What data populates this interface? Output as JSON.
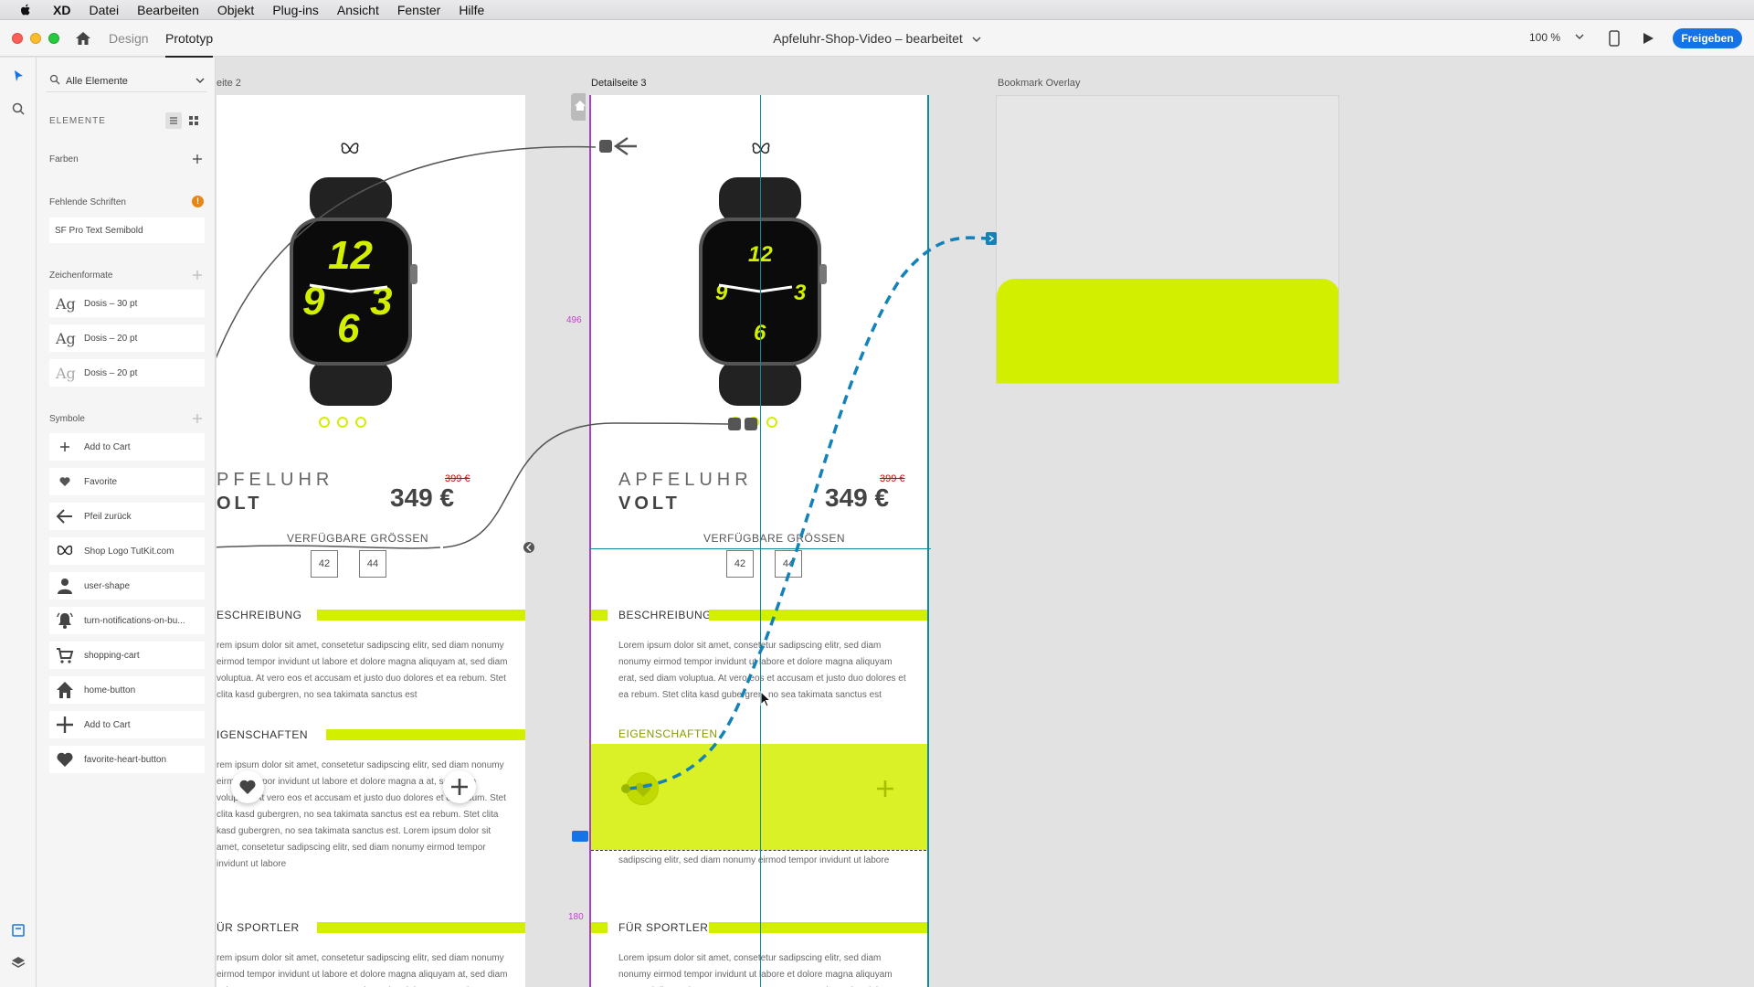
{
  "menubar": {
    "app": "XD",
    "items": [
      "Datei",
      "Bearbeiten",
      "Objekt",
      "Plug-ins",
      "Ansicht",
      "Fenster",
      "Hilfe"
    ]
  },
  "toolbar": {
    "tab_design": "Design",
    "tab_prototype": "Prototyp",
    "doc_title": "Apfeluhr-Shop-Video – bearbeitet",
    "zoom": "100 %",
    "share": "Freigeben"
  },
  "assets": {
    "filter": "Alle Elemente",
    "heading": "ELEMENTE",
    "colors": "Farben",
    "missing_fonts": "Fehlende Schriften",
    "missing_font_name": "SF Pro Text Semibold",
    "warn_badge": "!",
    "char_styles": "Zeichenformate",
    "char_style_items": [
      {
        "ag": "Ag",
        "label": "Dosis – 30 pt"
      },
      {
        "ag": "Ag",
        "label": "Dosis – 20 pt"
      },
      {
        "ag": "Ag",
        "label": "Dosis – 20 pt"
      }
    ],
    "symbols": "Symbole",
    "symbol_items": [
      {
        "label": "Add to Cart",
        "icon": "plus-icon"
      },
      {
        "label": "Favorite",
        "icon": "heart-icon"
      },
      {
        "label": "Pfeil zurück",
        "icon": "arrow-left-icon"
      },
      {
        "label": "Shop Logo TutKit.com",
        "icon": "butterfly-logo-icon"
      },
      {
        "label": "user-shape",
        "icon": "user-icon"
      },
      {
        "label": "turn-notifications-on-bu...",
        "icon": "bell-icon"
      },
      {
        "label": "shopping-cart",
        "icon": "cart-icon"
      },
      {
        "label": "home-button",
        "icon": "home-icon"
      },
      {
        "label": "Add to Cart",
        "icon": "plus-icon"
      },
      {
        "label": "favorite-heart-button",
        "icon": "heart-icon"
      }
    ]
  },
  "canvas": {
    "artboard2_label": "eite 2",
    "artboard3_label": "Detailseite 3",
    "bookmark_label": "Bookmark Overlay",
    "dim_top": "496",
    "dim_bottom": "180",
    "accent": "#d2ef00",
    "prototype_blue": "#1473e6",
    "product": {
      "name1_a2": "PFELUHR",
      "name2_a2": "OLT",
      "name1_a3": "APFELUHR",
      "name2_a3": "VOLT",
      "old_price": "399 €",
      "price": "349 €",
      "sizes_label": "VERFÜGBARE GRÖSSEN",
      "sizes": [
        "42",
        "44"
      ],
      "watch_numbers_a2": [
        "12",
        "9",
        "6",
        "3"
      ],
      "watch_numbers_a3": [
        "12",
        "9",
        "6",
        "3"
      ]
    },
    "sections_a2": [
      {
        "title": "ESCHREIBUNG"
      },
      {
        "title": "IGENSCHAFTEN"
      },
      {
        "title": "ÜR SPORTLER"
      }
    ],
    "sections_a3": [
      {
        "title": "BESCHREIBUNG"
      },
      {
        "title": "EIGENSCHAFTEN"
      },
      {
        "title": "FÜR SPORTLER"
      }
    ],
    "lorem_a2_1": "rem ipsum dolor sit amet, consetetur sadipscing elitr, sed diam nonumy eirmod tempor invidunt ut labore et dolore magna aliquyam at, sed diam voluptua. At vero eos et accusam et justo duo dolores et ea rebum. Stet clita kasd gubergren, no sea takimata sanctus est",
    "lorem_a2_2": "rem ipsum dolor sit amet, consetetur sadipscing elitr, sed diam nonumy eirmod tempor invidunt ut labore et dolore magna a at, sed diam voluptua. At vero eos et accusam et justo duo dolores et ea rebum. Stet clita kasd gubergren, no sea takimata sanctus est ea rebum. Stet clita kasd gubergren, no sea takimata sanctus est. Lorem ipsum dolor sit amet, consetetur sadipscing elitr, sed diam nonumy eirmod tempor invidunt ut labore",
    "lorem_a2_3": "rem ipsum dolor sit amet, consetetur sadipscing elitr, sed diam nonumy eirmod tempor invidunt ut labore et dolore magna aliquyam at, sed diam voluptua. At vero eos et accusam et justo duo dolores et ea rebum. Stet clita kasd gubergren, no sea takimata sanctus est",
    "lorem_a3_1": "Lorem ipsum dolor sit amet, consetetur sadipscing elitr, sed diam nonumy eirmod tempor invidunt ut labore et dolore magna aliquyam erat, sed diam voluptua. At vero eos et accusam et justo duo dolores et ea rebum. Stet clita kasd gubergren, no sea takimata sanctus est",
    "lorem_a3_2": "sadipscing elitr, sed diam nonumy eirmod tempor invidunt ut labore",
    "lorem_a3_3": "Lorem ipsum dolor sit amet, consetetur sadipscing elitr, sed diam nonumy eirmod tempor invidunt ut labore et dolore magna aliquyam erat, sed diam voluptua. At vero eos et accusam et justo duo dolores et ea rebum. Stet clita kasd gubergren, no sea takimata sanctus est"
  }
}
